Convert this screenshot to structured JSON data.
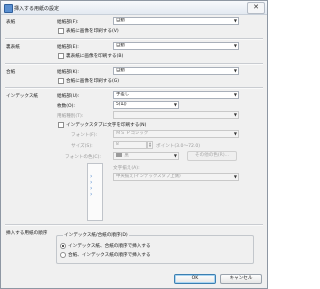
{
  "window": {
    "title": "挿入する用紙の設定",
    "close_label": "✕"
  },
  "cover": {
    "label": "表紙",
    "tray_label": "給紙部(F):",
    "tray_value": "自動",
    "print_label": "表紙に画像を印刷する(V)"
  },
  "back_cover": {
    "label": "裏表紙",
    "tray_label": "給紙部(E):",
    "tray_value": "自動",
    "print_label": "裏表紙に画像を印刷する(B)"
  },
  "slip_sheet": {
    "label": "合紙",
    "tray_label": "給紙部(K):",
    "tray_value": "自動",
    "print_label": "合紙に画像を印刷する(G)"
  },
  "index_paper": {
    "label": "インデックス紙",
    "tray_label": "給紙部(U):",
    "tray_value": "手差し",
    "count_label": "枚数(O):",
    "count_value": "5(山)",
    "paper_type_label": "用紙種別(T):",
    "paper_type_value": "",
    "tab_print_label": "インデックスタブに文字を印刷する(N)",
    "font_label": "フォント(F):",
    "font_value": "ＭＳ Ｐゴシック",
    "size_label": "サイズ(S):",
    "size_value": "8",
    "size_hint": "ポイント(3.0〜72.0)",
    "color_label": "フォントの色(C):",
    "color_value": "黒",
    "other_colors_label": "その他の色(R)...",
    "position_label": "文字揃え(A):",
    "position_value": "中央揃え(インデックスタブ上側)"
  },
  "insertion_order": {
    "label": "挿入する用紙の順序",
    "group_title": "インデックス紙/合紙の順序(D)",
    "options": [
      {
        "label": "インデックス紙、合紙の順序で挿入する",
        "selected": true
      },
      {
        "label": "合紙、インデックス紙の順序で挿入する",
        "selected": false
      }
    ]
  },
  "buttons": {
    "ok": "OK",
    "cancel": "キャンセル"
  },
  "colors": {
    "accent": "#3c7fb1",
    "title_bg": "#e3e9f1",
    "window_bg": "#f0f0f0",
    "tab_blue": "#5a8fd0"
  },
  "icons": {
    "app": "printer-icon",
    "close": "close-icon",
    "dropdown": "chevron-down-icon"
  }
}
